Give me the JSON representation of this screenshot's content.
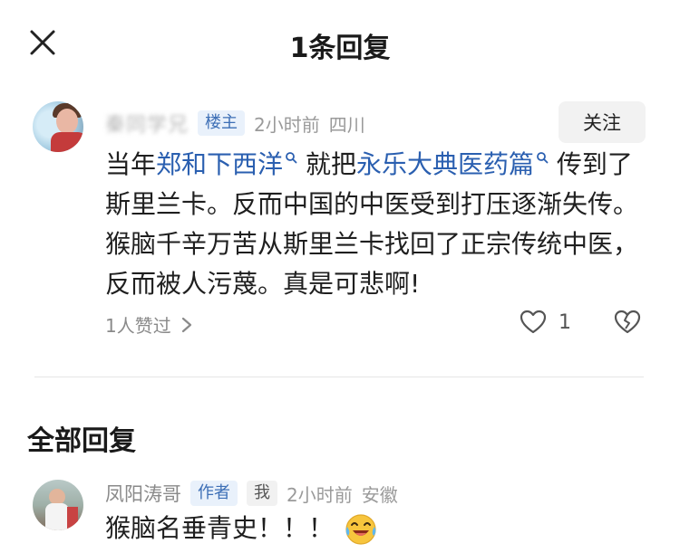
{
  "header": {
    "close_icon": "close-icon",
    "title": "1条回复"
  },
  "comment": {
    "username": "秦同学兄",
    "host_badge": "楼主",
    "time": "2小时前",
    "location": "四川",
    "follow_label": "关注",
    "text_1": "当年",
    "keyword_1": "郑和下西洋",
    "text_2": "就把",
    "keyword_2": "永乐大典医药篇",
    "text_3": "传到了斯里兰卡。反而中国的中医受到打压逐渐失传。猴脑千辛万苦从斯里兰卡找回了正宗传统中医，反而被人污蔑。真是可悲啊!",
    "likes_label": "1人赞过",
    "like_count": "1",
    "icons": {
      "search": "search-icon",
      "heart": "heart-icon",
      "dislike": "broken-heart-icon",
      "chevron": "chevron-right-icon"
    }
  },
  "section_title": "全部回复",
  "reply": {
    "username": "凤阳涛哥",
    "author_badge": "作者",
    "me_badge": "我",
    "time": "2小时前",
    "location": "安徽",
    "text": "猴脑名垂青史！！！",
    "emoji": "laughing-crying-emoji"
  },
  "colors": {
    "keyword": "#2a5fb0",
    "badge_bg": "#e9f1fb",
    "badge_text": "#3d6fb6",
    "muted": "#999999"
  }
}
